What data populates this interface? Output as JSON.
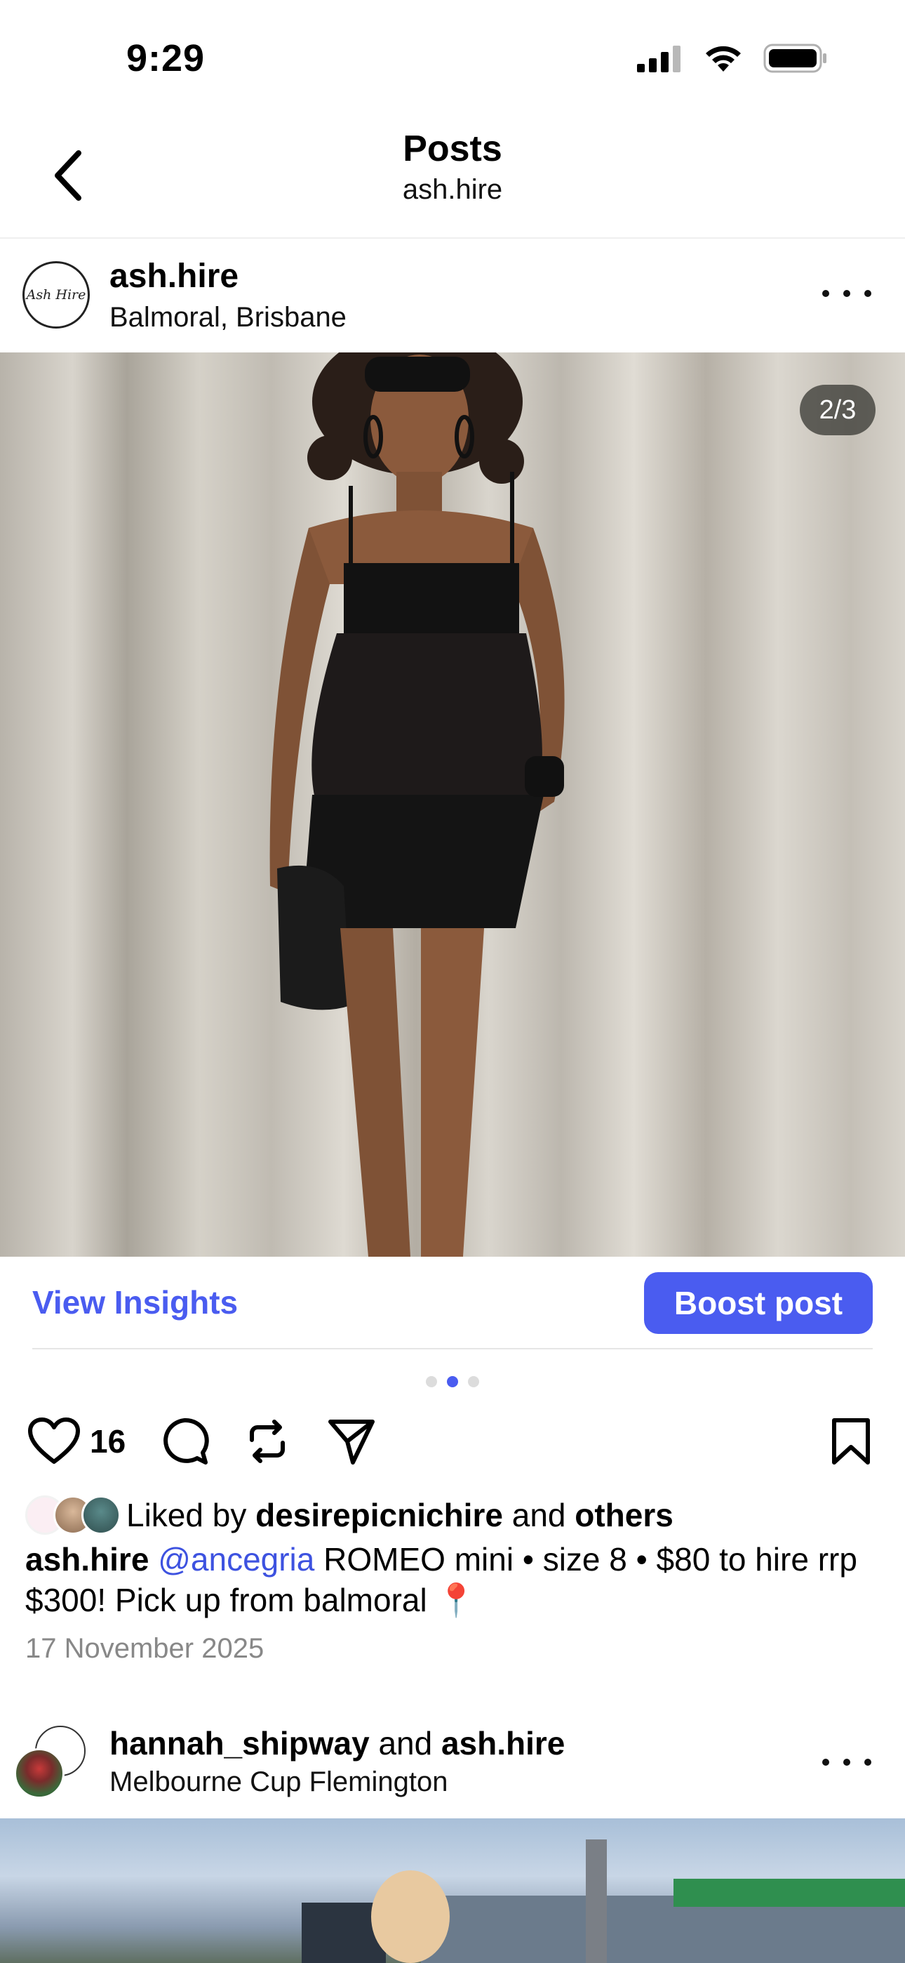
{
  "status_bar": {
    "time": "9:29"
  },
  "nav": {
    "title": "Posts",
    "subtitle": "ash.hire"
  },
  "post": {
    "avatar_text": "Ash Hire",
    "username": "ash.hire",
    "location": "Balmoral, Brisbane",
    "image_counter": "2/3",
    "view_insights_label": "View Insights",
    "boost_label": "Boost post",
    "carousel": {
      "count": 3,
      "active_index": 1
    },
    "like_count": "16",
    "likes": {
      "prefix": "Liked by",
      "first_liker": "desirepicnichire",
      "conjunction": "and",
      "others": "others"
    },
    "caption": {
      "username": "ash.hire",
      "mention": "@ancegria",
      "text": "ROMEO mini • size 8 • $80 to hire rrp $300! Pick up from balmoral 📍"
    },
    "date": "17 November 2025"
  },
  "post2": {
    "user1": "hannah_shipway",
    "conjunction": "and",
    "user2": "ash.hire",
    "location": "Melbourne Cup Flemington"
  },
  "icons": {
    "back": "chevron-left-icon",
    "more": "more-horizontal-icon",
    "like": "heart-icon",
    "comment": "comment-icon",
    "repost": "repost-icon",
    "share": "send-icon",
    "save": "bookmark-icon"
  },
  "colors": {
    "accent": "#4a5cf0",
    "mention": "#3d52e0",
    "muted": "#888888"
  }
}
